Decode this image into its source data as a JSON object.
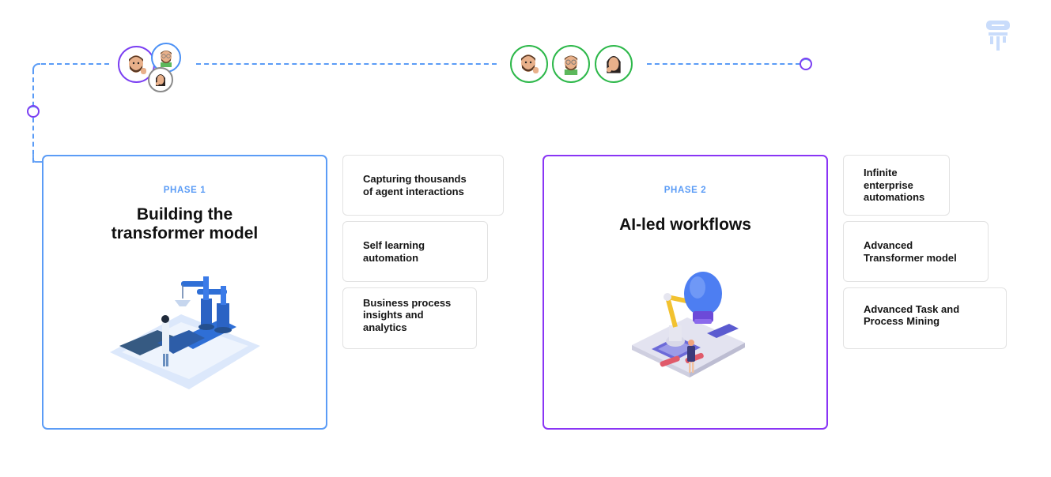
{
  "colors": {
    "phase1_border": "#5b9cf6",
    "phase2_border": "#8a35f5",
    "phase_label": "#5b9cf6",
    "connector": "#5b9cf6",
    "avatar_ring_purple": "#7b3ff2",
    "avatar_ring_blue": "#4a90f5",
    "avatar_ring_gray": "#8a8a8a",
    "avatar_ring_green": "#2db84a",
    "logo": "#c9dcfb"
  },
  "logo": {
    "icon": "brand-logo-icon"
  },
  "timeline": {
    "group1_avatars": [
      {
        "name": "avatar-bearded-man-thumbs-up",
        "ring": "purple"
      },
      {
        "name": "avatar-man-glasses",
        "ring": "blue"
      },
      {
        "name": "avatar-woman-thinking",
        "ring": "gray"
      }
    ],
    "group2_avatars": [
      {
        "name": "avatar-bearded-man-thumbs-up",
        "ring": "green"
      },
      {
        "name": "avatar-man-glasses",
        "ring": "green"
      },
      {
        "name": "avatar-woman-thinking",
        "ring": "green"
      }
    ]
  },
  "phases": [
    {
      "label": "PHASE 1",
      "title_line1": "Building the",
      "title_line2": "transformer model",
      "illustration": "robotic-arms-lab-illustration",
      "features": [
        {
          "line1": "Capturing thousands",
          "line2": "of agent interactions",
          "line3": ""
        },
        {
          "line1": "Self learning",
          "line2": "automation",
          "line3": ""
        },
        {
          "line1": "Business process",
          "line2": "insights and",
          "line3": "analytics"
        }
      ]
    },
    {
      "label": "PHASE 2",
      "title_line1": "AI-led workflows",
      "title_line2": "",
      "illustration": "lightbulb-chip-illustration",
      "features": [
        {
          "line1": "Infinite",
          "line2": "enterprise",
          "line3": "automations"
        },
        {
          "line1": "Advanced",
          "line2": "Transformer model",
          "line3": ""
        },
        {
          "line1": "Advanced Task and",
          "line2": "Process Mining",
          "line3": ""
        }
      ]
    }
  ]
}
